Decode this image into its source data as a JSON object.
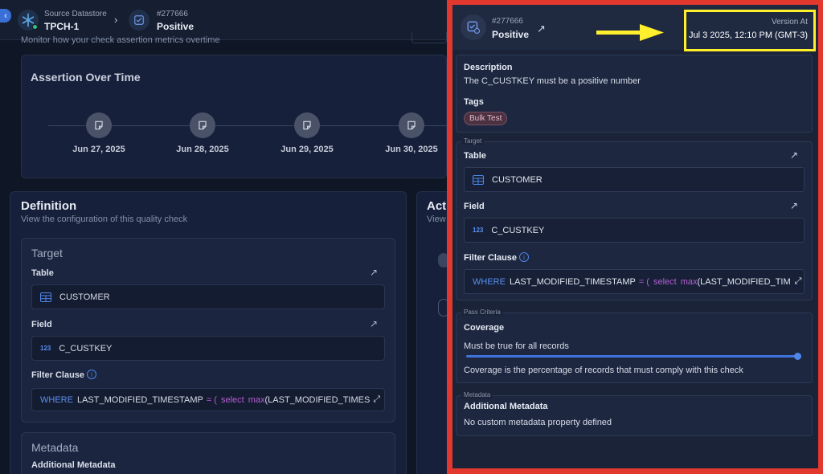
{
  "breadcrumb": {
    "source_label": "Source Datastore",
    "source_name": "TPCH-1",
    "check_id": "#277666",
    "check_name": "Positive"
  },
  "assertion": {
    "subtitle": "Monitor how your check assertion metrics overtime",
    "title": "Assertion Over Time",
    "dates": [
      "Jun 27, 2025",
      "Jun 28, 2025",
      "Jun 29, 2025",
      "Jun 30, 2025"
    ]
  },
  "definition": {
    "title": "Definition",
    "subtitle": "View the configuration of this quality check",
    "target_title": "Target",
    "table_label": "Table",
    "table_value": "CUSTOMER",
    "field_label": "Field",
    "field_value": "C_CUSTKEY",
    "field_type": "123",
    "filter_label": "Filter Clause",
    "filter_where": "WHERE",
    "filter_col": "LAST_MODIFIED_TIMESTAMP",
    "filter_eq": "= (",
    "filter_select": "select",
    "filter_max": "max",
    "filter_rest_left": "(LAST_MODIFIED_TIMES",
    "metadata_title": "Metadata",
    "additional_metadata": "Additional Metadata"
  },
  "activity": {
    "title_partial": "Act",
    "subtitle_partial": "View"
  },
  "drawer": {
    "check_id": "#277666",
    "check_name": "Positive",
    "version_label": "Version At",
    "version_value": "Jul 3 2025, 12:10 PM (GMT-3)",
    "description_label": "Description",
    "description_value": "The C_CUSTKEY must be a positive number",
    "tags_label": "Tags",
    "tag": "Bulk Test",
    "target_legend": "Target",
    "table_label": "Table",
    "table_value": "CUSTOMER",
    "field_label": "Field",
    "field_type": "123",
    "field_value": "C_CUSTKEY",
    "filter_label": "Filter Clause",
    "filter_where": "WHERE",
    "filter_col": "LAST_MODIFIED_TIMESTAMP",
    "filter_eq": "= (",
    "filter_select": "select",
    "filter_max": "max",
    "filter_rest": "(LAST_MODIFIED_TIM",
    "pass_legend": "Pass Criteria",
    "coverage_label": "Coverage",
    "coverage_rule": "Must be true for all records",
    "coverage_percent": 100,
    "coverage_help": "Coverage is the percentage of records that must comply with this check",
    "metadata_legend": "Metadata",
    "additional_metadata": "Additional Metadata",
    "metadata_empty": "No custom metadata property defined"
  },
  "colors": {
    "highlight_border": "#e3382e",
    "callout": "#ffef2d",
    "accent": "#3b6fd8"
  }
}
